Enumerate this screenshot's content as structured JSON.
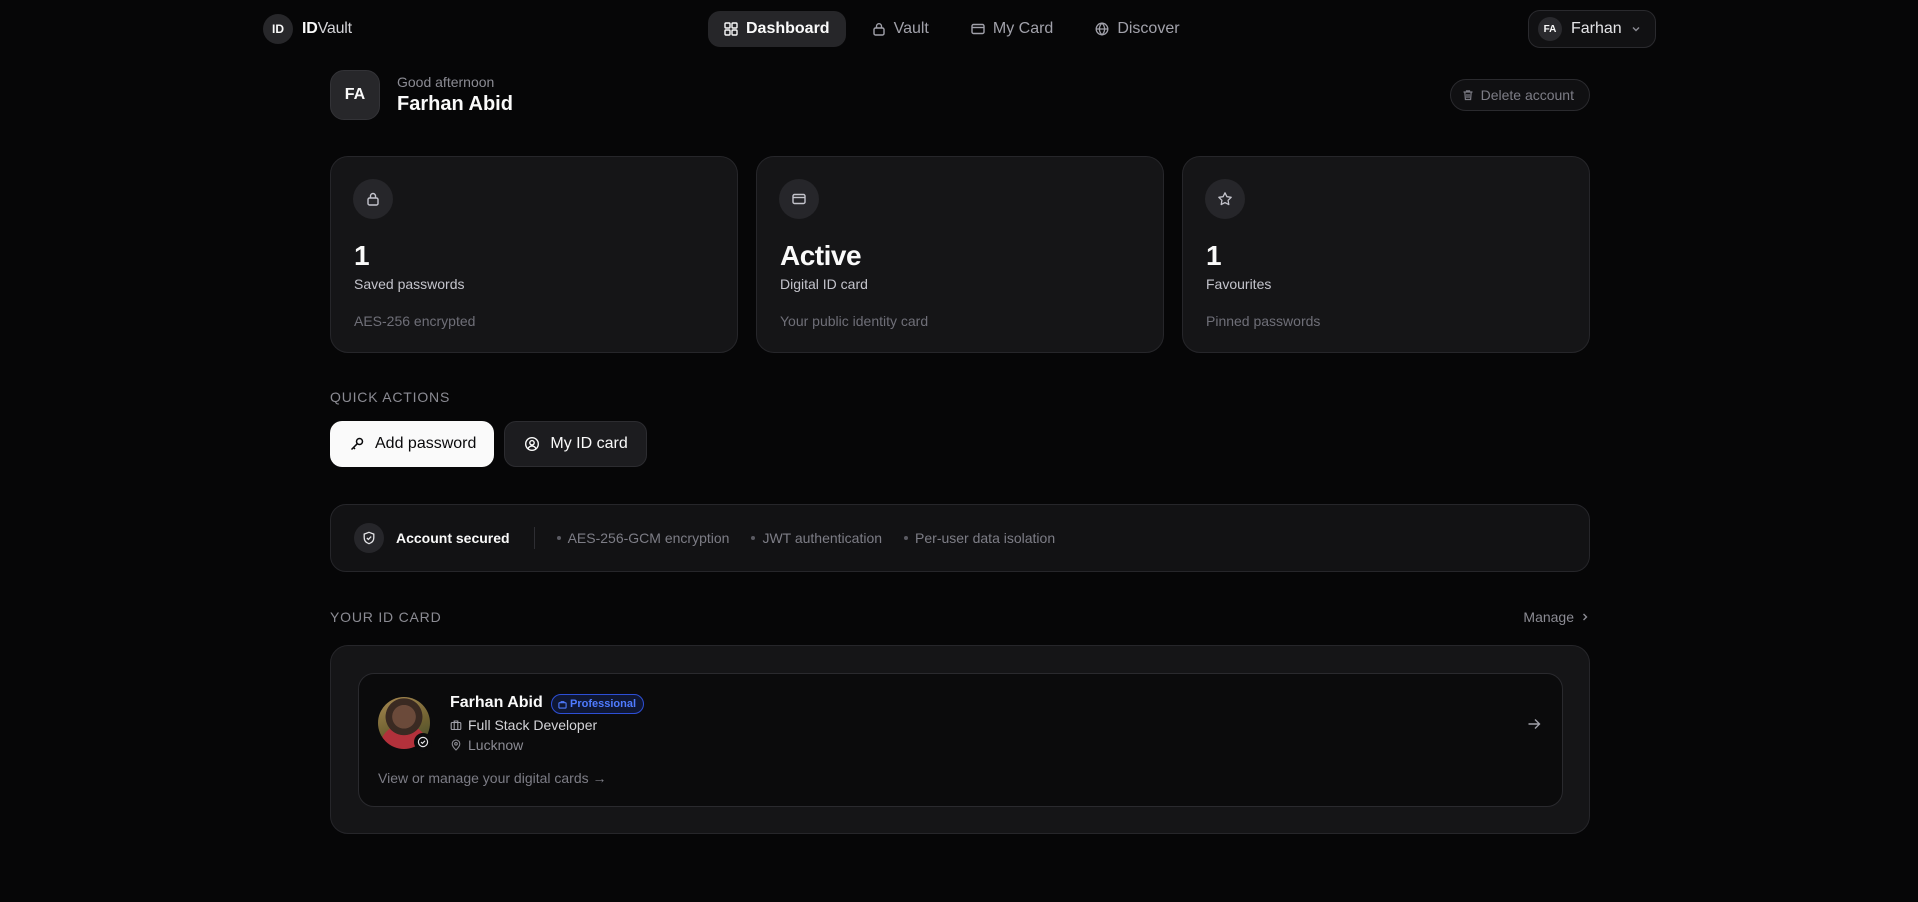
{
  "brand": {
    "badge": "ID",
    "name_bold": "ID",
    "name_rest": "Vault"
  },
  "nav": {
    "tabs": [
      {
        "label": "Dashboard",
        "icon": "grid-icon",
        "active": true
      },
      {
        "label": "Vault",
        "icon": "lock-icon",
        "active": false
      },
      {
        "label": "My Card",
        "icon": "card-icon",
        "active": false
      },
      {
        "label": "Discover",
        "icon": "globe-icon",
        "active": false
      }
    ],
    "user": {
      "initials": "FA",
      "name": "Farhan"
    }
  },
  "greeting": {
    "initials": "FA",
    "subtitle": "Good afternoon",
    "name": "Farhan Abid"
  },
  "delete_account_label": "Delete account",
  "stats": [
    {
      "icon": "lock-icon",
      "value": "1",
      "label": "Saved passwords",
      "note": "AES-256 encrypted"
    },
    {
      "icon": "card-icon",
      "value": "Active",
      "label": "Digital ID card",
      "note": "Your public identity card"
    },
    {
      "icon": "star-icon",
      "value": "1",
      "label": "Favourites",
      "note": "Pinned passwords"
    }
  ],
  "quick_actions": {
    "heading": "QUICK ACTIONS",
    "add_password": "Add password",
    "my_id_card": "My ID card"
  },
  "security": {
    "title": "Account secured",
    "items": [
      "AES-256-GCM encryption",
      "JWT authentication",
      "Per-user data isolation"
    ]
  },
  "id_section": {
    "heading": "YOUR ID CARD",
    "manage": "Manage",
    "card": {
      "name": "Farhan Abid",
      "badge": "Professional",
      "role": "Full Stack Developer",
      "location": "Lucknow",
      "hint": "View or manage your digital cards →"
    }
  },
  "colors": {
    "background": "#060607",
    "card": "#151517",
    "accent_badge": "#4f7bff"
  }
}
